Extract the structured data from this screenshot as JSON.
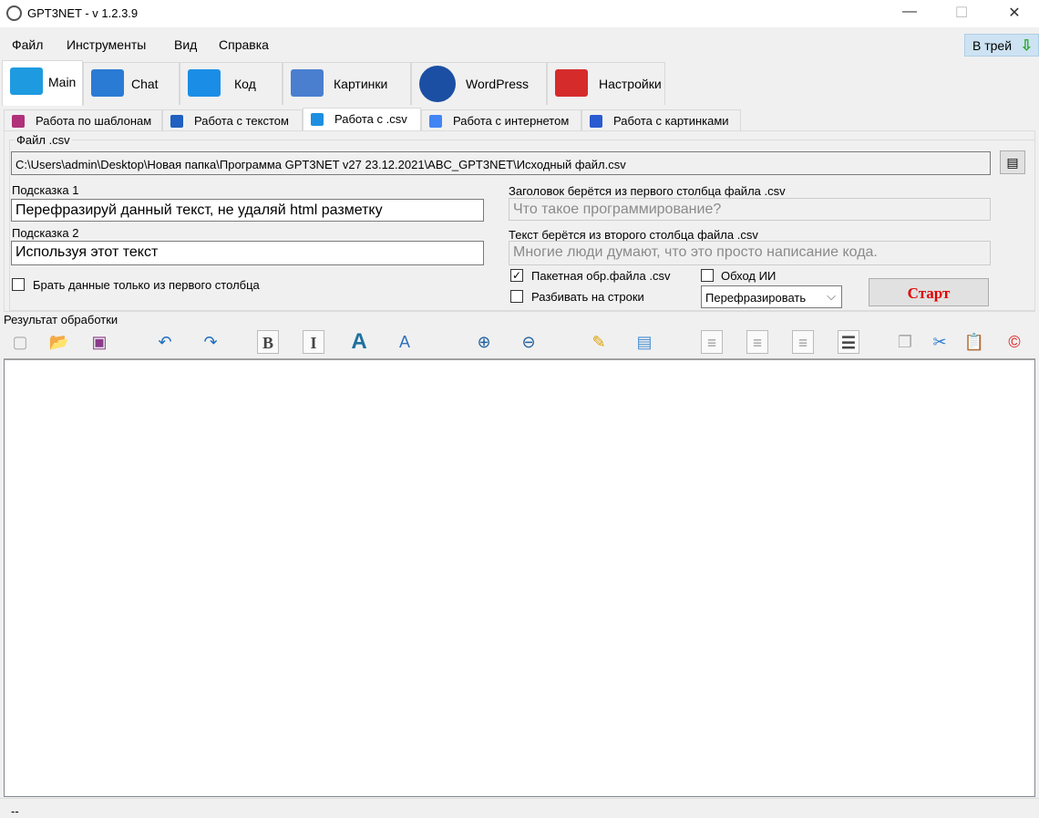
{
  "window": {
    "title": "GPT3NET - v 1.2.3.9",
    "minimize": "—",
    "maximize": "☐",
    "close": "✕"
  },
  "menu": {
    "items": [
      "Файл",
      "Инструменты",
      "Вид",
      "Справка"
    ],
    "tray_button": "В трей"
  },
  "main_tabs": [
    {
      "label": "Main",
      "color": "#1e9be0"
    },
    {
      "label": "Chat",
      "color": "#2a7bd4"
    },
    {
      "label": "Код",
      "color": "#1a8ee6"
    },
    {
      "label": "Картинки",
      "color": "#4a7fd0"
    },
    {
      "label": "WordPress",
      "color": "#1b4fa3"
    },
    {
      "label": "Настройки",
      "color": "#d62b2b"
    }
  ],
  "sub_tabs": [
    {
      "label": "Работа по шаблонам",
      "color": "#b0307a"
    },
    {
      "label": "Работа с текстом",
      "color": "#2060c0"
    },
    {
      "label": "Работа с .csv",
      "color": "#1e8fe0"
    },
    {
      "label": "Работа с интернетом",
      "color": "#4285f4"
    },
    {
      "label": "Работа с картинками",
      "color": "#2a5bd0"
    }
  ],
  "form": {
    "group_label": "Файл .csv",
    "file_path": "C:\\Users\\admin\\Desktop\\Новая папка\\Программа GPT3NET v27 23.12.2021\\ABC_GPT3NET\\Исходный файл.csv",
    "hint1_label": "Подсказка 1",
    "hint1_value": "Перефразируй данный текст, не удаляй html разметку",
    "hint2_label": "Подсказка 2",
    "hint2_value": "Используя этот текст",
    "first_col_only": "Брать данные только из первого столбца",
    "title_label": "Заголовок берётся из первого столбца файла .csv",
    "title_value": "Что такое программирование?",
    "text_label": "Текст берётся из второго столбца файла .csv",
    "text_value": "Многие люди думают, что это просто написание кода.",
    "batch": "Пакетная обр.файла .csv",
    "batch_checked": true,
    "bypass": "Обход ИИ",
    "split": "Разбивать на строки",
    "mode": "Перефразировать",
    "start": "Старт"
  },
  "result": {
    "label": "Результат обработки",
    "content": ""
  },
  "toolbar": [
    {
      "name": "new-icon",
      "glyph": "▢",
      "color": "#aaa"
    },
    {
      "name": "open-icon",
      "glyph": "📂",
      "color": "#d9a520"
    },
    {
      "name": "save-icon",
      "glyph": "▣",
      "color": "#8a3c8a"
    },
    {
      "name": "undo-icon",
      "glyph": "↶",
      "color": "#1e6fc0"
    },
    {
      "name": "redo-icon",
      "glyph": "↷",
      "color": "#1e6fc0"
    },
    {
      "name": "bold-icon",
      "glyph": "B",
      "color": "#444"
    },
    {
      "name": "italic-icon",
      "glyph": "I",
      "color": "#444"
    },
    {
      "name": "font-icon",
      "glyph": "A",
      "color": "#1e6fa0"
    },
    {
      "name": "font-color-icon",
      "glyph": "A",
      "color": "#3070c0"
    },
    {
      "name": "zoom-in-icon",
      "glyph": "⊕",
      "color": "#2060a0"
    },
    {
      "name": "zoom-out-icon",
      "glyph": "⊖",
      "color": "#2060a0"
    },
    {
      "name": "highlight-icon",
      "glyph": "✎",
      "color": "#e0a000"
    },
    {
      "name": "insert-image-icon",
      "glyph": "▤",
      "color": "#4a90d0"
    },
    {
      "name": "align-left-icon",
      "glyph": "≡",
      "color": "#999"
    },
    {
      "name": "align-center-icon",
      "glyph": "≡",
      "color": "#999"
    },
    {
      "name": "align-right-icon",
      "glyph": "≡",
      "color": "#999"
    },
    {
      "name": "list-icon",
      "glyph": "☰",
      "color": "#444"
    },
    {
      "name": "copy-icon",
      "glyph": "❐",
      "color": "#aaa"
    },
    {
      "name": "cut-icon",
      "glyph": "✂",
      "color": "#2a7ad0"
    },
    {
      "name": "paste-icon",
      "glyph": "📋",
      "color": "#a07040"
    },
    {
      "name": "copyright-icon",
      "glyph": "©",
      "color": "#e02020"
    }
  ],
  "status": {
    "text": "--"
  }
}
